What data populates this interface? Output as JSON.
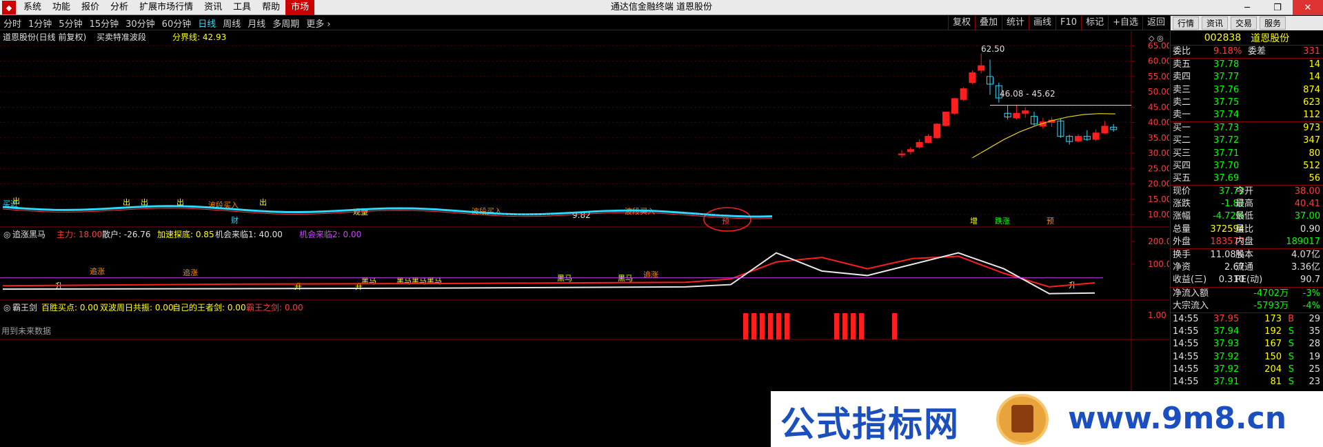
{
  "menu": {
    "items": [
      "系统",
      "功能",
      "报价",
      "分析",
      "扩展市场行情",
      "资讯",
      "工具",
      "帮助"
    ],
    "active_item": "市场",
    "title": "通达信金融终端  道恩股份"
  },
  "window_controls": [
    "─",
    "❐",
    "✕"
  ],
  "periods": {
    "items": [
      "分时",
      "1分钟",
      "5分钟",
      "15分钟",
      "30分钟",
      "60分钟",
      "日线",
      "周线",
      "月线",
      "多周期",
      "更多 ›"
    ],
    "active": "日线",
    "tools": [
      "复权",
      "叠加",
      "统计",
      "画线",
      "F10",
      "标记",
      "+自选",
      "返回"
    ]
  },
  "chart_data": [
    {
      "type": "candlestick",
      "title": "道恩股份(日线 前复权)",
      "indicator": "买卖特准波段",
      "divider_label": "分界线: 42.93",
      "y_ticks": [
        65.0,
        60.0,
        55.0,
        50.0,
        45.0,
        40.0,
        35.0,
        30.0,
        25.0,
        20.0,
        15.0,
        10.0
      ],
      "ylim": [
        8,
        68
      ],
      "max_label": "62.50",
      "min_label": "9.82",
      "range_label": "46.08 - 45.62",
      "candles": [
        {
          "o": 29.5,
          "c": 29.8,
          "h": 31,
          "l": 28.5,
          "up": true
        },
        {
          "o": 30.5,
          "c": 31.2,
          "h": 32,
          "l": 29.6,
          "up": true
        },
        {
          "o": 32.0,
          "c": 33.5,
          "h": 34.5,
          "l": 31.5,
          "up": true
        },
        {
          "o": 33.5,
          "c": 35.5,
          "h": 36.2,
          "l": 33.2,
          "up": true
        },
        {
          "o": 35.0,
          "c": 39.5,
          "h": 39.8,
          "l": 34.8,
          "up": true
        },
        {
          "o": 39.0,
          "c": 43.4,
          "h": 43.6,
          "l": 38.8,
          "up": true
        },
        {
          "o": 43.0,
          "c": 47.8,
          "h": 48.0,
          "l": 42.5,
          "up": true
        },
        {
          "o": 47.5,
          "c": 51.0,
          "h": 51.5,
          "l": 47.0,
          "up": true
        },
        {
          "o": 53.0,
          "c": 56.2,
          "h": 57.0,
          "l": 52.5,
          "up": true
        },
        {
          "o": 57.0,
          "c": 58.5,
          "h": 62.5,
          "l": 56.0,
          "up": true
        },
        {
          "o": 55.0,
          "c": 52.5,
          "h": 60.5,
          "l": 49.0,
          "up": false
        },
        {
          "o": 52.0,
          "c": 48.0,
          "h": 53.0,
          "l": 46.5,
          "up": false
        },
        {
          "o": 43.0,
          "c": 41.8,
          "h": 45.5,
          "l": 41.0,
          "up": false
        },
        {
          "o": 41.5,
          "c": 43.0,
          "h": 45.8,
          "l": 41.0,
          "up": true
        },
        {
          "o": 43.0,
          "c": 43.8,
          "h": 45.0,
          "l": 41.5,
          "up": true
        },
        {
          "o": 42.0,
          "c": 39.5,
          "h": 43.5,
          "l": 39.0,
          "up": false
        },
        {
          "o": 38.8,
          "c": 40.2,
          "h": 41.5,
          "l": 38.0,
          "up": true
        },
        {
          "o": 40.0,
          "c": 40.8,
          "h": 41.8,
          "l": 38.6,
          "up": true
        },
        {
          "o": 40.5,
          "c": 35.5,
          "h": 41.2,
          "l": 35.0,
          "up": false
        },
        {
          "o": 35.5,
          "c": 33.8,
          "h": 36.0,
          "l": 32.8,
          "up": false
        },
        {
          "o": 34.0,
          "c": 35.5,
          "h": 36.2,
          "l": 33.5,
          "up": true
        },
        {
          "o": 35.5,
          "c": 34.5,
          "h": 37.5,
          "l": 34.0,
          "up": false
        },
        {
          "o": 34.5,
          "c": 36.6,
          "h": 37.8,
          "l": 34.0,
          "up": true
        },
        {
          "o": 36.6,
          "c": 38.8,
          "h": 40.5,
          "l": 36.2,
          "up": true
        },
        {
          "o": 38.5,
          "c": 37.7,
          "h": 39.5,
          "l": 37.0,
          "up": false
        }
      ],
      "ma_line": [
        28.5,
        31.5,
        34.5,
        37.0,
        39.0,
        40.6,
        41.8,
        42.6,
        42.9,
        42.8
      ],
      "signal_labels": [
        "买进",
        "出",
        "出",
        "出",
        "出",
        "出",
        "波段买入",
        "波段买入",
        "波段买入",
        "观望",
        "财",
        "预",
        "增",
        "跌涨",
        "预"
      ]
    },
    {
      "type": "line",
      "title": "追涨黑马",
      "legend": [
        {
          "name": "主力: 18.00",
          "color": "#ff3c3c"
        },
        {
          "name": "散户: -26.76",
          "color": "#e0e0e0"
        },
        {
          "name": "加速探底: 0.85",
          "color": "#ffff00"
        },
        {
          "name": "机会来临1: 40.00",
          "color": "#e0e0e0"
        },
        {
          "name": "机会来临2: 0.00",
          "color": "#cc44ff"
        }
      ],
      "y_ticks": [
        200.0,
        100.0
      ],
      "ylim": [
        -40,
        240
      ],
      "signal_labels": [
        "追涨",
        "追涨",
        "追涨",
        "黑马",
        "黑马黑马黑马",
        "黑马",
        "黑马",
        "升",
        "升",
        "升",
        "升"
      ],
      "series": [
        {
          "name": "主力",
          "values": [
            5,
            12,
            15,
            20,
            35,
            110,
            130,
            80,
            125,
            135,
            60,
            0,
            18
          ]
        },
        {
          "name": "散户",
          "values": [
            -10,
            -8,
            -5,
            0,
            10,
            150,
            70,
            50,
            100,
            150,
            80,
            -30,
            -27
          ]
        }
      ]
    },
    {
      "type": "bar",
      "title": "霸王剑",
      "legend": [
        {
          "name": "百胜买点: 0.00",
          "color": "#ffff00"
        },
        {
          "name": "双波周日共振: 0.00",
          "color": "#ffff00"
        },
        {
          "name": "自己的王者剑: 0.00",
          "color": "#ffff00"
        },
        {
          "name": "霸王之剑: 0.00",
          "color": "#ff3c3c"
        }
      ],
      "y_ticks": [
        1.0
      ],
      "bottom_text": "用到未来数据"
    }
  ],
  "quote": {
    "tabs": [
      "行情",
      "资讯",
      "交易",
      "服务"
    ],
    "code": "002838",
    "name": "道恩股份",
    "weibi": {
      "l1": "委比",
      "v1": "9.18%",
      "l2": "委差",
      "v2": "331"
    },
    "sell": [
      {
        "label": "卖五",
        "price": "37.78",
        "vol": "14"
      },
      {
        "label": "卖四",
        "price": "37.77",
        "vol": "14"
      },
      {
        "label": "卖三",
        "price": "37.76",
        "vol": "874"
      },
      {
        "label": "卖二",
        "price": "37.75",
        "vol": "623"
      },
      {
        "label": "卖一",
        "price": "37.74",
        "vol": "112"
      }
    ],
    "buy": [
      {
        "label": "买一",
        "price": "37.73",
        "vol": "973"
      },
      {
        "label": "买二",
        "price": "37.72",
        "vol": "347"
      },
      {
        "label": "买三",
        "price": "37.71",
        "vol": "80"
      },
      {
        "label": "买四",
        "price": "37.70",
        "vol": "512"
      },
      {
        "label": "买五",
        "price": "37.69",
        "vol": "56"
      }
    ],
    "stats": [
      {
        "l1": "现价",
        "v1": "37.73",
        "c1": "green",
        "l2": "今开",
        "v2": "38.00",
        "c2": "red"
      },
      {
        "l1": "涨跌",
        "v1": "-1.87",
        "c1": "green",
        "l2": "最高",
        "v2": "40.41",
        "c2": "red"
      },
      {
        "l1": "涨幅",
        "v1": "-4.72%",
        "c1": "green",
        "l2": "最低",
        "v2": "37.00",
        "c2": "green"
      },
      {
        "l1": "总量",
        "v1": "372594",
        "c1": "yellow",
        "l2": "量比",
        "v2": "0.90",
        "c2": "white"
      },
      {
        "l1": "外盘",
        "v1": "183577",
        "c1": "red",
        "l2": "内盘",
        "v2": "189017",
        "c2": "green"
      }
    ],
    "stats2": [
      {
        "l1": "换手",
        "v1": "11.08%",
        "l2": "股本",
        "v2": "4.07亿"
      },
      {
        "l1": "净资",
        "v1": "2.67",
        "l2": "流通",
        "v2": "3.36亿"
      },
      {
        "l1": "收益(三)",
        "v1": "0.310",
        "l2": "PE(动)",
        "v2": "90.7"
      }
    ],
    "flows": [
      {
        "label": "净流入额",
        "value": "-4702万",
        "pct": "-3%"
      },
      {
        "label": "大宗流入",
        "value": "-5793万",
        "pct": "-4%"
      }
    ],
    "ticks": [
      {
        "time": "14:55",
        "price": "37.95",
        "vol": "173",
        "side": "B",
        "n": "29",
        "color": "red"
      },
      {
        "time": "14:55",
        "price": "37.94",
        "vol": "192",
        "side": "S",
        "n": "35",
        "color": "green"
      },
      {
        "time": "14:55",
        "price": "37.93",
        "vol": "167",
        "side": "S",
        "n": "28",
        "color": "green"
      },
      {
        "time": "14:55",
        "price": "37.92",
        "vol": "150",
        "side": "S",
        "n": "19",
        "color": "green"
      },
      {
        "time": "14:55",
        "price": "37.92",
        "vol": "204",
        "side": "S",
        "n": "25",
        "color": "green"
      },
      {
        "time": "14:55",
        "price": "37.91",
        "vol": "81",
        "side": "S",
        "n": "23",
        "color": "green"
      }
    ]
  },
  "watermark": {
    "text1": "公式指标网",
    "text2": "www.9m8.cn"
  },
  "colors": {
    "up": "#ff1e1e",
    "down": "#2cd9ff",
    "grid": "#8b0000",
    "accent": "#c00000"
  }
}
